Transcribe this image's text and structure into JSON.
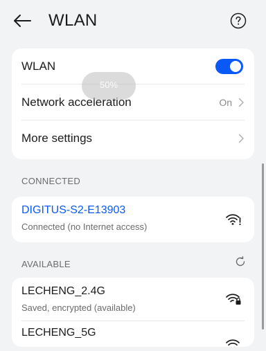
{
  "header": {
    "title": "WLAN",
    "back_icon": "arrow-left-icon",
    "help_icon": "question-circle-icon"
  },
  "settings": {
    "wlan": {
      "label": "WLAN",
      "enabled": true
    },
    "network_acceleration": {
      "label": "Network acceleration",
      "value": "On"
    },
    "more_settings": {
      "label": "More settings"
    }
  },
  "overlay": {
    "percent": "50%"
  },
  "connected": {
    "section_label": "CONNECTED",
    "network": {
      "name": "DIGITUS-S2-E13903",
      "status": "Connected (no Internet access)",
      "icon": "wifi-no-internet-icon"
    }
  },
  "available": {
    "section_label": "AVAILABLE",
    "scan_icon": "refresh-icon",
    "networks": [
      {
        "name": "LECHENG_2.4G",
        "status": "Saved, encrypted (available)",
        "icon": "wifi-locked-icon"
      },
      {
        "name": "LECHENG_5G",
        "status": "",
        "icon": "wifi-icon"
      }
    ]
  },
  "colors": {
    "accent": "#0a59f7",
    "background": "#f1f3f5",
    "card": "#ffffff",
    "secondary_text": "#6b6b6b"
  }
}
